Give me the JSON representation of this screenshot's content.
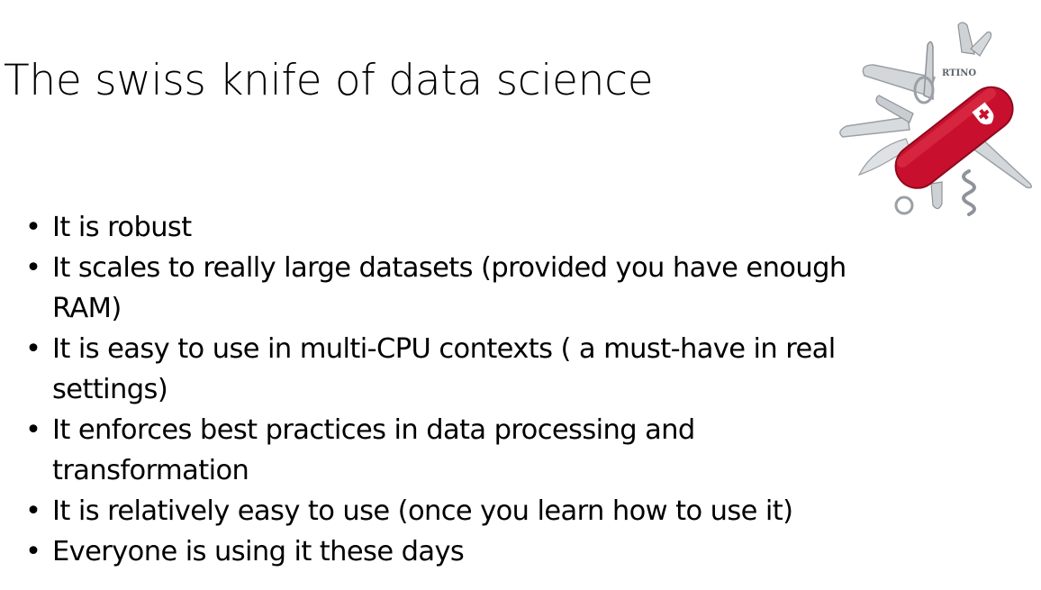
{
  "slide": {
    "title": "The swiss knife of data science",
    "bullet_glyph": "•",
    "bullets": [
      "It is robust",
      "It scales to really large datasets (provided you have enough RAM)",
      "It is easy to use in multi-CPU contexts ( a must-have in real settings)",
      "It enforces best practices in data processing and transformation",
      "It is relatively easy to use (once you learn how to use it)",
      "Everyone is using it these days"
    ],
    "image": {
      "icon": "swiss-army-knife-icon",
      "engraving": "RTINO",
      "colors": {
        "handle": "#c8102e",
        "handle_dark": "#8e0a1e",
        "blade": "#d4d7da",
        "blade_edge": "#9aa0a6"
      }
    }
  }
}
